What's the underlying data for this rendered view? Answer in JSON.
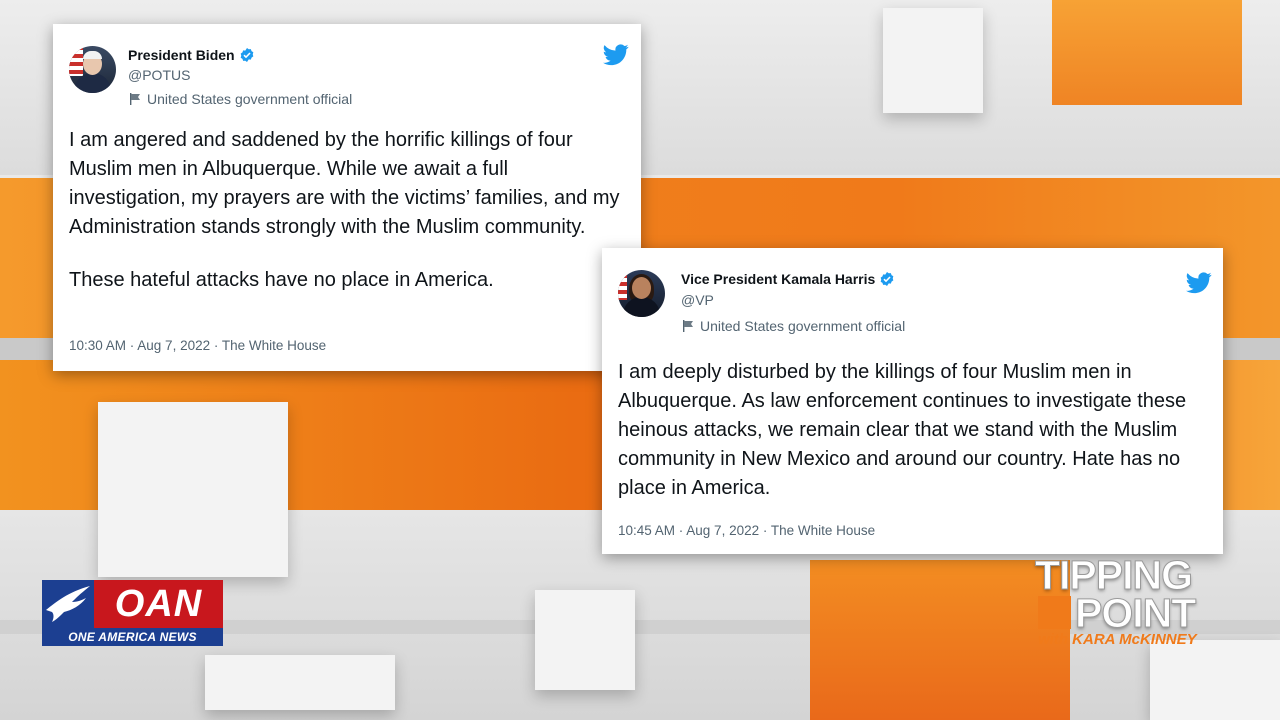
{
  "tweets": [
    {
      "name": "President Biden",
      "handle": "@POTUS",
      "label": "United States government official",
      "paragraphs": [
        "I am angered and saddened by the horrific killings of four Muslim men in Albuquerque. While we await a full investigation, my prayers are with the victims’ families, and my Administration stands strongly with the Muslim community.",
        "These hateful attacks have no place in America."
      ],
      "meta": "10:30 AM · Aug 7, 2022 · The White House"
    },
    {
      "name": "Vice President Kamala Harris",
      "handle": "@VP",
      "label": "United States government official",
      "paragraphs": [
        "I am deeply disturbed by the killings of four Muslim men in Albuquerque. As law enforcement continues to investigate these heinous attacks, we remain clear that we stand with the Muslim community in New Mexico and around our country. Hate has no place in America."
      ],
      "meta": "10:45 AM · Aug 7, 2022 · The White House"
    }
  ],
  "logos": {
    "oan_letters": "OAN",
    "oan_tagline": "ONE AMERICA NEWS",
    "show_line1": "TIPPING",
    "show_line2": "POINT",
    "show_line3": "with KARA McKINNEY"
  },
  "icons": {
    "verified": "verified-badge-icon",
    "bird": "twitter-bird-icon",
    "flag": "flag-icon"
  },
  "colors": {
    "twitter_blue": "#1d9bf0",
    "accent_orange": "#f07a1a",
    "oan_red": "#c8171d",
    "oan_blue": "#1c3f91"
  }
}
